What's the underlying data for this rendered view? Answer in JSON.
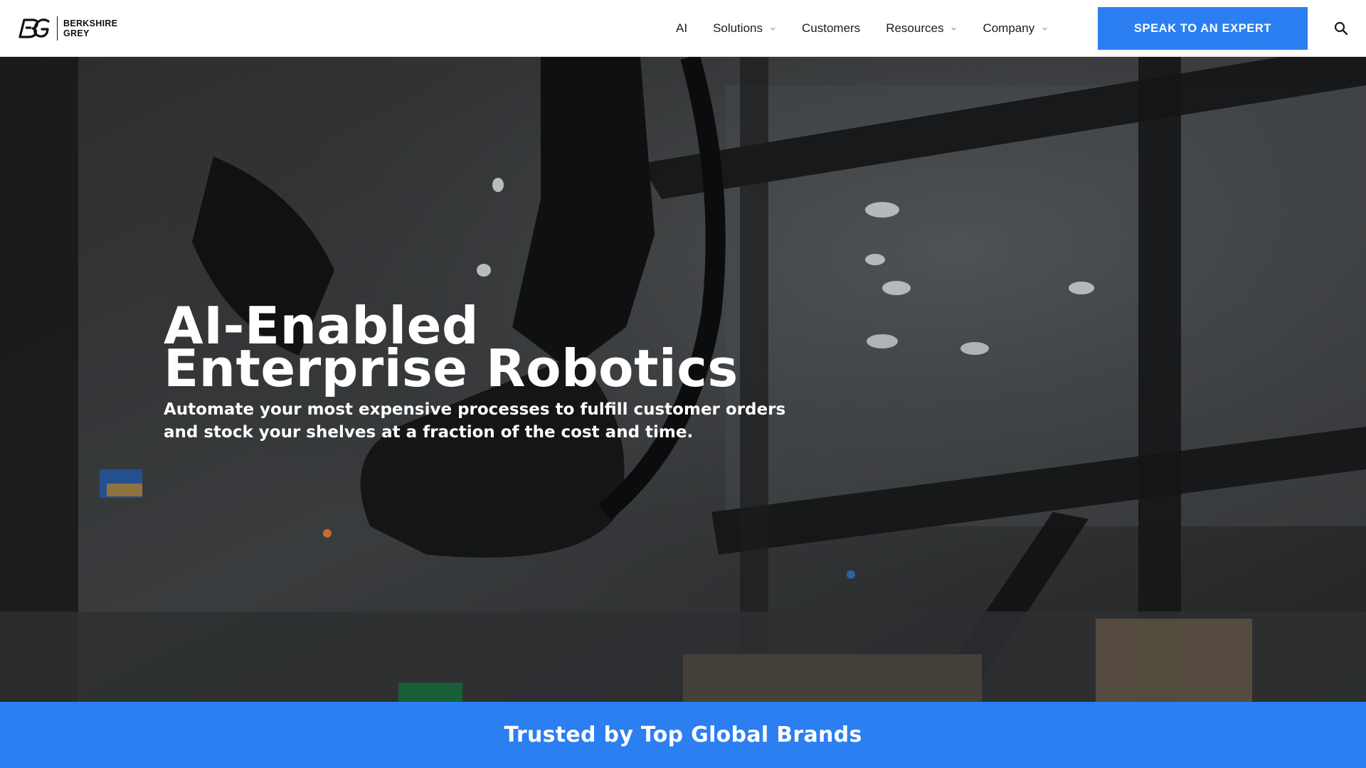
{
  "brand": {
    "line1": "BERKSHIRE",
    "line2": "GREY",
    "logo_icon": "bg-monogram-icon"
  },
  "nav": {
    "items": [
      {
        "label": "AI",
        "has_dropdown": false
      },
      {
        "label": "Solutions",
        "has_dropdown": true
      },
      {
        "label": "Customers",
        "has_dropdown": false
      },
      {
        "label": "Resources",
        "has_dropdown": true
      },
      {
        "label": "Company",
        "has_dropdown": true
      }
    ],
    "cta_label": "SPEAK TO AN EXPERT",
    "search_icon": "search-icon"
  },
  "hero": {
    "title_line1": "AI-Enabled",
    "title_line2": "Enterprise Robotics",
    "subtitle": "Automate your most expensive processes to fulfill customer orders and stock your shelves at a fraction of the cost and time."
  },
  "band": {
    "title": "Trusted by Top Global Brands"
  },
  "colors": {
    "accent": "#2b7ff0",
    "header_bg": "#ffffff",
    "text_dark": "#1c1c1c"
  }
}
